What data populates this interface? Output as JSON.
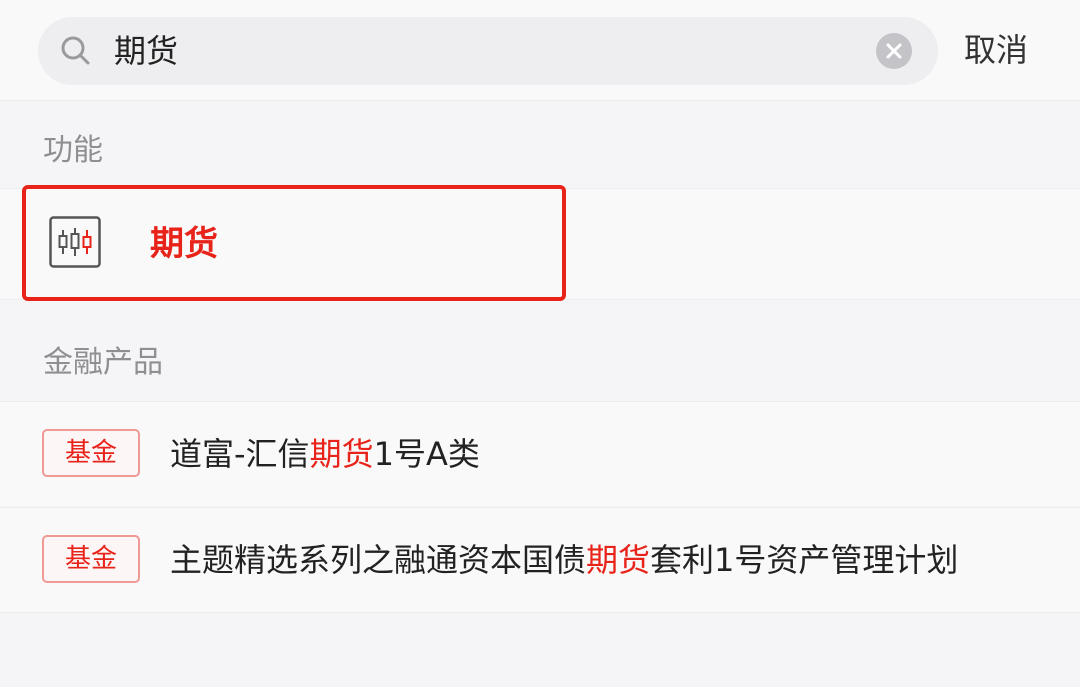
{
  "search": {
    "value": "期货",
    "cancel_label": "取消"
  },
  "sections": {
    "functions_title": "功能",
    "products_title": "金融产品"
  },
  "functions": [
    {
      "label": "期货",
      "icon": "futures-candlestick-icon"
    }
  ],
  "products": [
    {
      "badge": "基金",
      "name_before": "道富-汇信",
      "name_match": "期货",
      "name_after": "1号A类"
    },
    {
      "badge": "基金",
      "name_before": "主题精选系列之融通资本国债",
      "name_match": "期货",
      "name_after": "套利1号资产管理计划"
    }
  ],
  "colors": {
    "accent": "#e8231a",
    "background": "#f5f5f7",
    "section_title": "#8e8e93"
  }
}
